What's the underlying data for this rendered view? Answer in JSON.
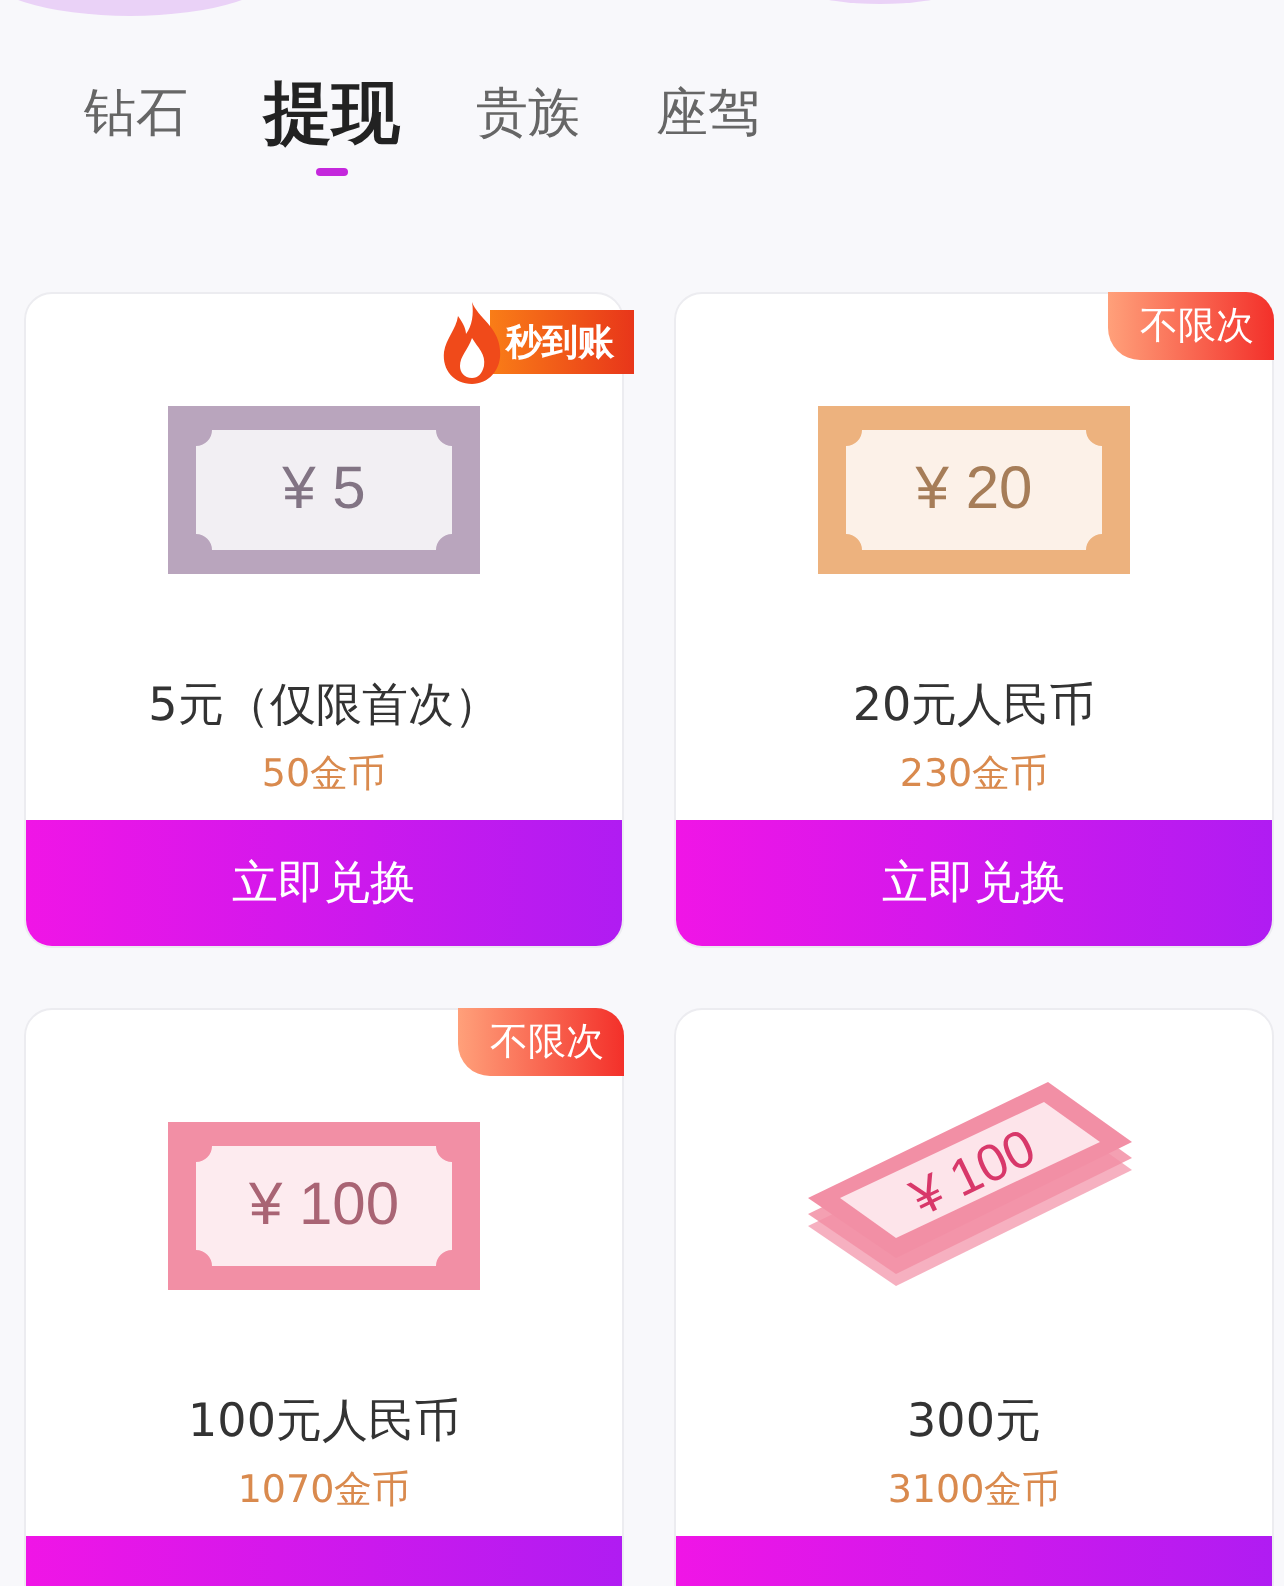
{
  "tabs": [
    {
      "label": "钻石",
      "selected": false
    },
    {
      "label": "提现",
      "selected": true
    },
    {
      "label": "贵族",
      "selected": false
    },
    {
      "label": "座驾",
      "selected": false
    }
  ],
  "cards": [
    {
      "badge": {
        "kind": "flame",
        "label": "秒到账"
      },
      "bill": {
        "kind": "flat",
        "color": "#b9a5bd",
        "amount": "¥ 5"
      },
      "title": "5元（仅限首次）",
      "price": "50金币",
      "button_label": "立即兑换"
    },
    {
      "badge": {
        "kind": "corner",
        "label": "不限次"
      },
      "bill": {
        "kind": "flat",
        "color": "#edb27e",
        "amount": "¥ 20"
      },
      "title": "20元人民币",
      "price": "230金币",
      "button_label": "立即兑换"
    },
    {
      "badge": {
        "kind": "corner",
        "label": "不限次"
      },
      "bill": {
        "kind": "flat",
        "color": "#f28fa5",
        "amount": "¥ 100"
      },
      "title": "100元人民币",
      "price": "1070金币"
    },
    {
      "bill": {
        "kind": "stack",
        "color": "#f28fa5",
        "amount": "¥ 100"
      },
      "title": "300元",
      "price": "3100金币"
    }
  ]
}
